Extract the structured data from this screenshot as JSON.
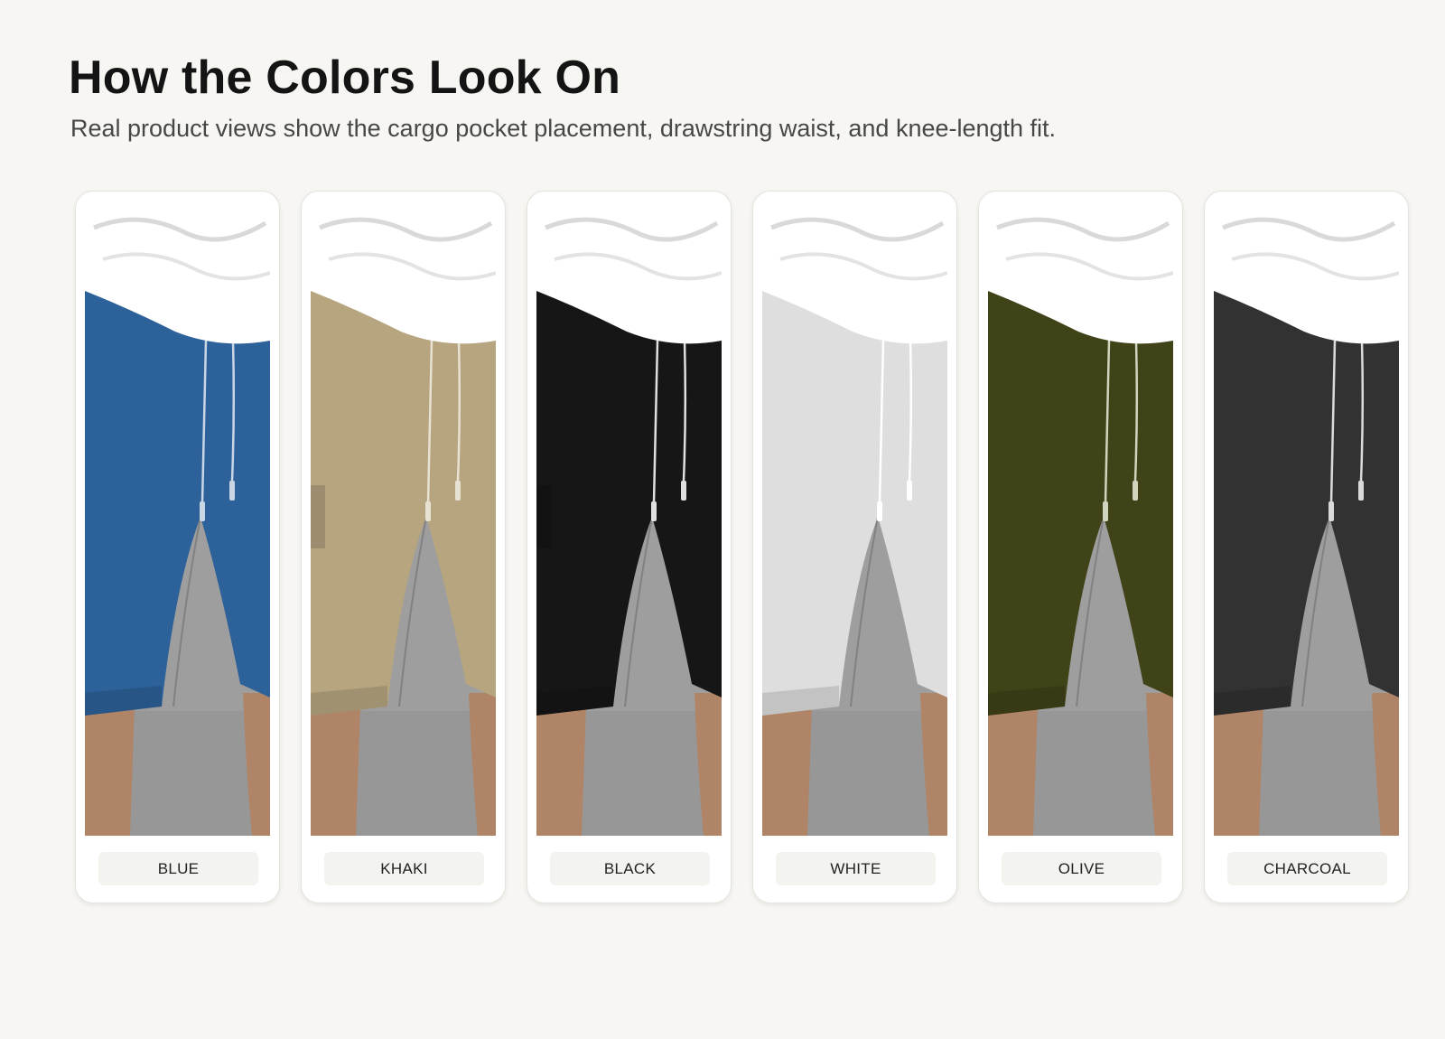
{
  "header": {
    "title": "How the Colors Look On",
    "subtitle": "Real product views show the cargo pocket placement, drawstring waist, and knee-length fit."
  },
  "swatches": [
    {
      "label": "BLUE",
      "color": "#2d6199",
      "cord": "#c9d6e6"
    },
    {
      "label": "KHAKI",
      "color": "#b7a580",
      "cord": "#e8e2d2"
    },
    {
      "label": "BLACK",
      "color": "#161616",
      "cord": "#e0e0e0"
    },
    {
      "label": "WHITE",
      "color": "#dedede",
      "cord": "#ffffff"
    },
    {
      "label": "OLIVE",
      "color": "#3f4317",
      "cord": "#d2d5bd"
    },
    {
      "label": "CHARCOAL",
      "color": "#323232",
      "cord": "#dadada"
    }
  ],
  "colors": {
    "background": "#f7f6f2",
    "shirt": "#ffffff",
    "floor": "#9e9e9e",
    "skin": "#b08466"
  }
}
